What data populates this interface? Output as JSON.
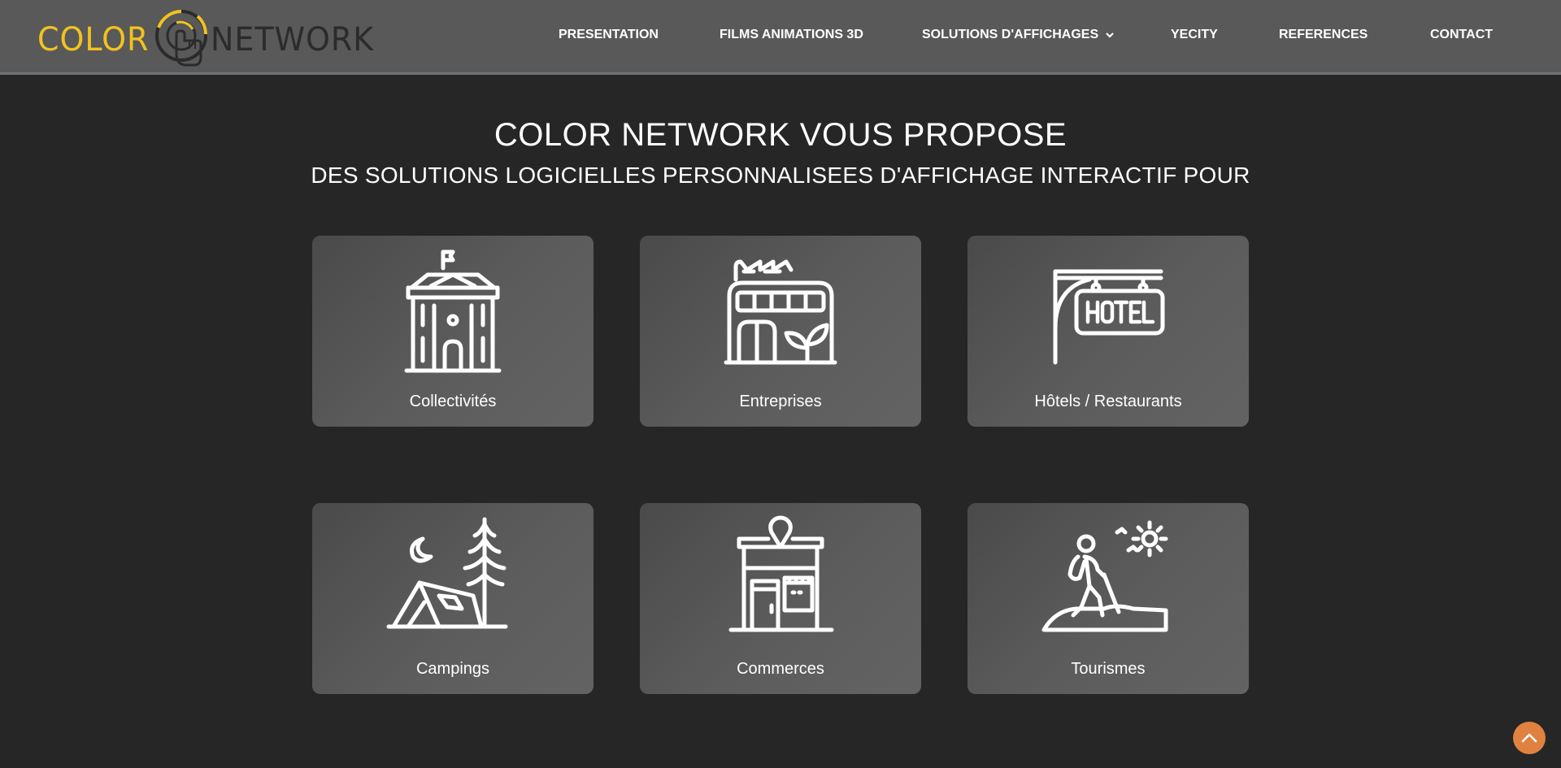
{
  "header": {
    "logo": {
      "word1": "COLOR",
      "word2": "NETWORK"
    },
    "nav": [
      {
        "label": "PRESENTATION"
      },
      {
        "label": "FILMS ANIMATIONS 3D"
      },
      {
        "label": "SOLUTIONS D'AFFICHAGES"
      },
      {
        "label": "YECITY"
      },
      {
        "label": "REFERENCES"
      },
      {
        "label": "CONTACT"
      }
    ]
  },
  "main": {
    "title": "COLOR NETWORK VOUS PROPOSE",
    "subtitle": "DES SOLUTIONS LOGICIELLES PERSONNALISEES D'AFFICHAGE INTERACTIF POUR",
    "cards": [
      {
        "label": "Collectivités",
        "icon": "town-hall-icon"
      },
      {
        "label": "Entreprises",
        "icon": "factory-icon"
      },
      {
        "label": "Hôtels / Restaurants",
        "icon": "hotel-sign-icon"
      },
      {
        "label": "Campings",
        "icon": "tent-icon"
      },
      {
        "label": "Commerces",
        "icon": "shop-icon"
      },
      {
        "label": "Tourismes",
        "icon": "hiker-icon"
      }
    ]
  },
  "colors": {
    "background": "#262626",
    "header": "#595959",
    "logo_accent": "#f2c21f",
    "scroll_button": "#e0823f"
  }
}
